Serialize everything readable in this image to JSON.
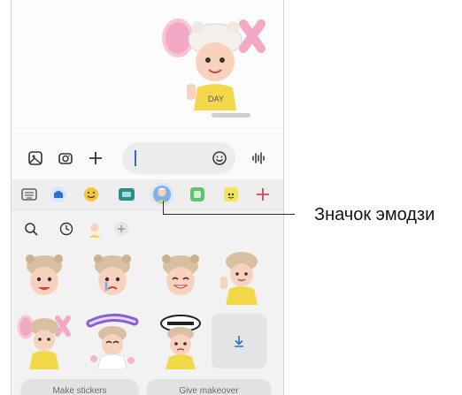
{
  "chat": {
    "sticker_name": "ok-bear-avatar-sticker"
  },
  "input_bar": {
    "gallery_icon": "gallery-icon",
    "camera_icon": "camera-icon",
    "add_icon": "plus-icon",
    "emoji_icon": "emoji-smile-icon",
    "voice_icon": "voice-waveform-icon"
  },
  "tabs": [
    {
      "icon": "keyboard-icon"
    },
    {
      "icon": "home-app-icon"
    },
    {
      "icon": "emoji-face-icon"
    },
    {
      "icon": "gif-icon"
    },
    {
      "icon": "ar-emoji-icon",
      "active": true
    },
    {
      "icon": "sticker-icon"
    },
    {
      "icon": "bitmoji-icon"
    },
    {
      "icon": "add-icon"
    }
  ],
  "subbar": {
    "search_icon": "search-icon",
    "recent_icon": "clock-icon",
    "avatar_icon": "avatar-icon",
    "add_icon": "plus-circle-icon"
  },
  "stickers": [
    {
      "name": "sticker-bear-hat-smile"
    },
    {
      "name": "sticker-bear-hat-cry"
    },
    {
      "name": "sticker-bear-hat-grin"
    },
    {
      "name": "sticker-bear-hat-wave"
    },
    {
      "name": "sticker-ok"
    },
    {
      "name": "sticker-thanks"
    },
    {
      "name": "sticker-sorry"
    },
    {
      "name": "sticker-download"
    }
  ],
  "bottom": {
    "make_stickers": "Make stickers",
    "give_makeover": "Give makeover"
  },
  "callout": {
    "label": "Значок эмодзи"
  },
  "colors": {
    "accent": "#2b6fd6",
    "tab_active_bg": "#dde8f5",
    "panel_bg": "#f2f2f2"
  }
}
